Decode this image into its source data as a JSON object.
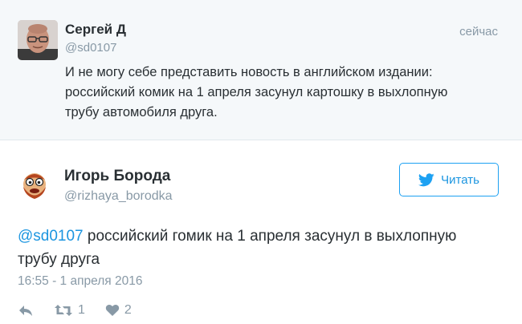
{
  "parent_tweet": {
    "name": "Сергей Д",
    "handle": "@sd0107",
    "time": "сейчас",
    "text_lines": [
      "И не могу себе представить новость в английском издании:",
      "российский комик на 1 апреля засунул картошку в выхлопную",
      "трубу автомобиля друга."
    ]
  },
  "tweet": {
    "name": "Игорь Борода",
    "handle": "@rizhaya_borodka",
    "follow_label": "Читать",
    "mention": "@sd0107",
    "text_rest": " российский гомик на 1 апреля засунул в выхлопную",
    "text_line2": "трубу друга",
    "timestamp": "16:55 - 1 апреля 2016",
    "retweets": "1",
    "likes": "2"
  },
  "icons": {
    "follow": "twitter-bird-icon",
    "reply": "reply-icon",
    "retweet": "retweet-icon",
    "like": "heart-icon"
  },
  "colors": {
    "accent": "#1b95e0",
    "muted": "#8899a6",
    "text": "#292f33",
    "parent_bg": "#f5f8fa"
  }
}
